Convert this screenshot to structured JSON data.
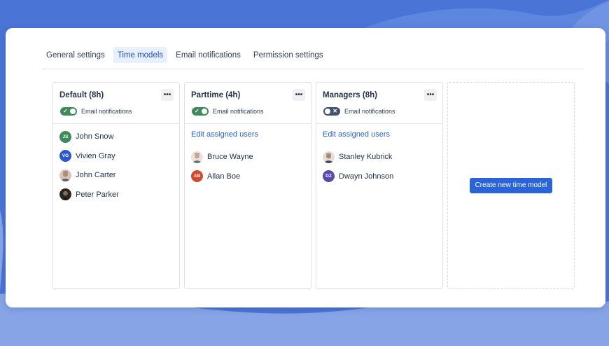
{
  "colors": {
    "background": "#4d78d8",
    "accent": "#2a64d8",
    "toggle_on": "#3d8a5a",
    "toggle_off": "#42526e"
  },
  "tabs": [
    {
      "label": "General settings",
      "active": false
    },
    {
      "label": "Time models",
      "active": true
    },
    {
      "label": "Email notifications",
      "active": false
    },
    {
      "label": "Permission settings",
      "active": false
    }
  ],
  "models": [
    {
      "title": "Default (8h)",
      "more_icon": "more-icon",
      "email_label": "Email notifications",
      "email_on": true,
      "edit_link": "",
      "users": [
        {
          "name": "John Snow",
          "initials": "JS",
          "avatar_color": "#3d8a5a",
          "photo": false
        },
        {
          "name": "Vivien Gray",
          "initials": "VG",
          "avatar_color": "#2a57c9",
          "photo": false
        },
        {
          "name": "John Carter",
          "initials": "",
          "avatar_color": "#b08d7a",
          "photo": true
        },
        {
          "name": "Peter Parker",
          "initials": "",
          "avatar_color": "#3a2d27",
          "photo": true
        }
      ]
    },
    {
      "title": "Parttime (4h)",
      "more_icon": "more-icon",
      "email_label": "Email notifications",
      "email_on": true,
      "edit_link": "Edit assigned users",
      "users": [
        {
          "name": "Bruce Wayne",
          "initials": "",
          "avatar_color": "#c9a48e",
          "photo": true
        },
        {
          "name": "Allan Boe",
          "initials": "AB",
          "avatar_color": "#d24a2e",
          "photo": false
        }
      ]
    },
    {
      "title": "Managers (8h)",
      "more_icon": "more-icon",
      "email_label": "Email notifications",
      "email_on": false,
      "edit_link": "Edit assigned users",
      "users": [
        {
          "name": "Stanley Kubrick",
          "initials": "",
          "avatar_color": "#a88672",
          "photo": true
        },
        {
          "name": "Dwayn Johnson",
          "initials": "DZ",
          "avatar_color": "#5a48b3",
          "photo": false
        }
      ]
    }
  ],
  "create_button": "Create new time model"
}
